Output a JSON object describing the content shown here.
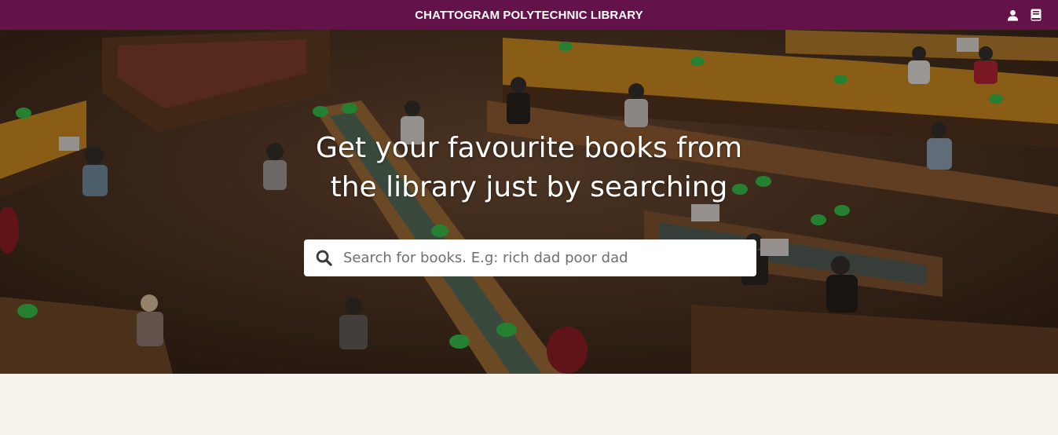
{
  "navbar": {
    "brand": "CHATTOGRAM POLYTECHNIC LIBRARY",
    "background_color": "#63134a",
    "icons": [
      "user-icon",
      "book-icon"
    ]
  },
  "hero": {
    "title_line1": "Get your favourite books from",
    "title_line2": "the library just by searching"
  },
  "search": {
    "placeholder": "Search for books. E.g: rich dad poor dad",
    "value": "",
    "icon": "search-icon"
  },
  "page": {
    "background_color": "#f7f2ec"
  }
}
